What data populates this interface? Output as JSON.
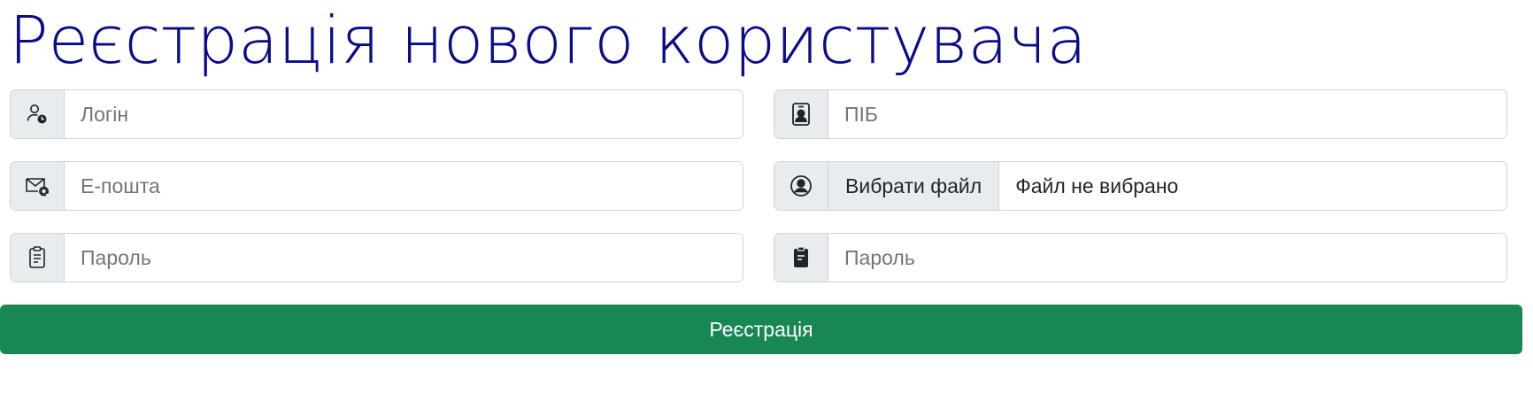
{
  "page": {
    "title": "Реєстрація нового користувача"
  },
  "form": {
    "login": {
      "placeholder": "Логін",
      "icon": "person-clock-icon"
    },
    "email": {
      "placeholder": "Е-пошта",
      "icon": "envelope-at-icon"
    },
    "password": {
      "placeholder": "Пароль",
      "icon": "clipboard-text-icon"
    },
    "full_name": {
      "placeholder": "ПІБ",
      "icon": "person-badge-icon"
    },
    "avatar": {
      "button_label": "Вибрати файл",
      "status": "Файл не вибрано",
      "icon": "person-circle-icon"
    },
    "password_confirm": {
      "placeholder": "Пароль",
      "icon": "clipboard-filled-icon"
    },
    "submit_label": "Реєстрація"
  },
  "colors": {
    "title": "#0a0a8c",
    "submit_bg": "#198754",
    "addon_bg": "#e9ecef",
    "border": "#ced4da"
  }
}
